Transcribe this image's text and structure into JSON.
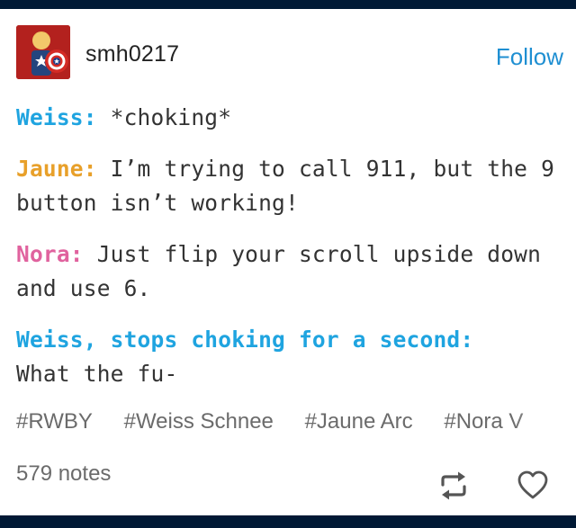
{
  "post": {
    "username": "smh0217",
    "follow_label": "Follow",
    "dialogue": [
      {
        "speaker": "Weiss:",
        "line": "*choking*",
        "color": "#1fa4e0"
      },
      {
        "speaker": "Jaune:",
        "line": "I’m trying to call 911, but the 9 button isn’t working!",
        "color": "#e8a02a"
      },
      {
        "speaker": "Nora:",
        "line": "Just flip your scroll upside down and use 6.",
        "color": "#e0629e"
      },
      {
        "speaker": "Weiss, stops choking for a second:",
        "line": "What the fu-",
        "color": "#1fa4e0"
      }
    ],
    "tags": [
      "#RWBY",
      "#Weiss Schnee",
      "#Jaune Arc",
      "#Nora V"
    ],
    "notes": "579 notes"
  },
  "icons": {
    "avatar": "captain-america-avatar",
    "reblog": "reblog-icon",
    "like": "heart-icon"
  }
}
